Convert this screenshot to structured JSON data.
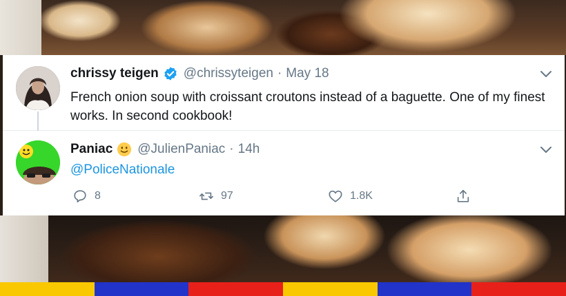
{
  "tweet_main": {
    "name": "chrissy teigen",
    "handle": "@chrissyteigen",
    "separator": "·",
    "time": "May 18",
    "text": "French onion soup with croissant croutons instead of a baguette. One of my finest works. In second cookbook!",
    "verified_icon": "verified-badge-icon"
  },
  "tweet_reply": {
    "name": "Paniac",
    "name_emoji_icon": "slightly-smiling-face-icon",
    "handle": "@JulienPaniac",
    "separator": "·",
    "time": "14h",
    "text": "@PoliceNationale",
    "replies": "8",
    "retweets": "97",
    "likes": "1.8K"
  },
  "icons": {
    "reply": "reply-icon",
    "retweet": "retweet-icon",
    "like": "heart-icon",
    "share": "share-icon",
    "menu": "chevron-down-icon"
  },
  "colors": {
    "link": "#1b95e0",
    "verified": "#1da1f2",
    "muted": "#657786",
    "stripe": [
      "#f9c800",
      "#2233c9",
      "#e8201a",
      "#f9c800",
      "#2233c9",
      "#e8201a"
    ]
  }
}
